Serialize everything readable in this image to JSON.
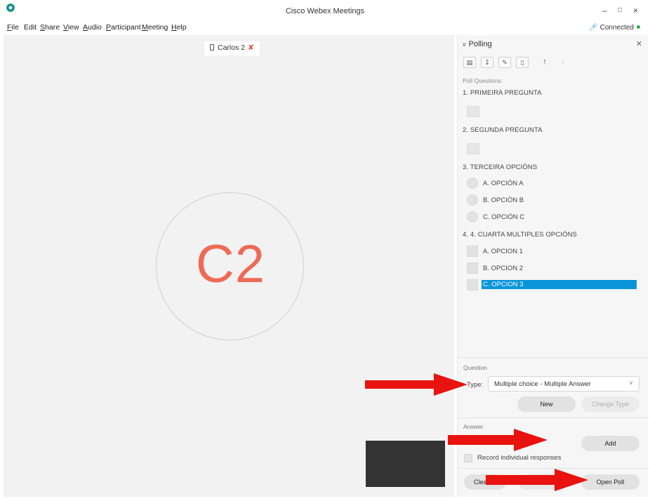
{
  "window": {
    "title": "Cisco Webex Meetings",
    "controls": {
      "minimize": "–",
      "restore": "🗗",
      "close": "×"
    }
  },
  "menu": {
    "items": [
      {
        "first": "F",
        "rest": "ile"
      },
      {
        "first": "",
        "rest": "Edit"
      },
      {
        "first": "S",
        "rest": "hare"
      },
      {
        "first": "V",
        "rest": "iew"
      },
      {
        "first": "A",
        "rest": "udio"
      },
      {
        "first": "P",
        "rest": "articipant"
      },
      {
        "first": "M",
        "rest": "eeting"
      },
      {
        "first": "H",
        "rest": "elp"
      }
    ],
    "status": "Connected",
    "status_color": "#26b24b"
  },
  "video": {
    "participant_name": "Carlos 2",
    "avatar_initials": "C2",
    "avatar_color": "#ee6a55"
  },
  "polling": {
    "title": "Polling",
    "toolbar_icons": [
      "open-icon",
      "save-icon",
      "edit-icon",
      "delete-icon",
      "move-up-icon",
      "move-down-icon"
    ],
    "questions_label": "Poll Questions:",
    "questions": [
      {
        "text": "1. PRIMEIRA PREGUNTA"
      },
      {
        "text": "2. SEGUNDA PREGUNTA"
      },
      {
        "text": "3. TERCEIRA OPCIÓNS",
        "options": [
          "A. OPCIÓN A",
          "B. OPCIÓN B",
          "C. OPCIÓN C"
        ]
      },
      {
        "text": "4. 4. CUARTA MULTIPLES OPCIÓNS",
        "options": [
          "A. OPCION 1",
          "B. OPCION 2",
          "C. OPCION 3"
        ]
      }
    ],
    "selected_color": "#0795d8",
    "question_section": {
      "label": "Question",
      "type_label": "Type:",
      "type_value": "Multiple choice - Multiple Answer",
      "new_label": "New",
      "change_type_label": "Change Type"
    },
    "answer_section": {
      "label": "Answer",
      "add_label": "Add",
      "record_label": "Record individual responses"
    },
    "footer": {
      "clear_label": "Clea",
      "open_poll_label": "Open Poll"
    }
  },
  "annotation_color": "#e8130f"
}
